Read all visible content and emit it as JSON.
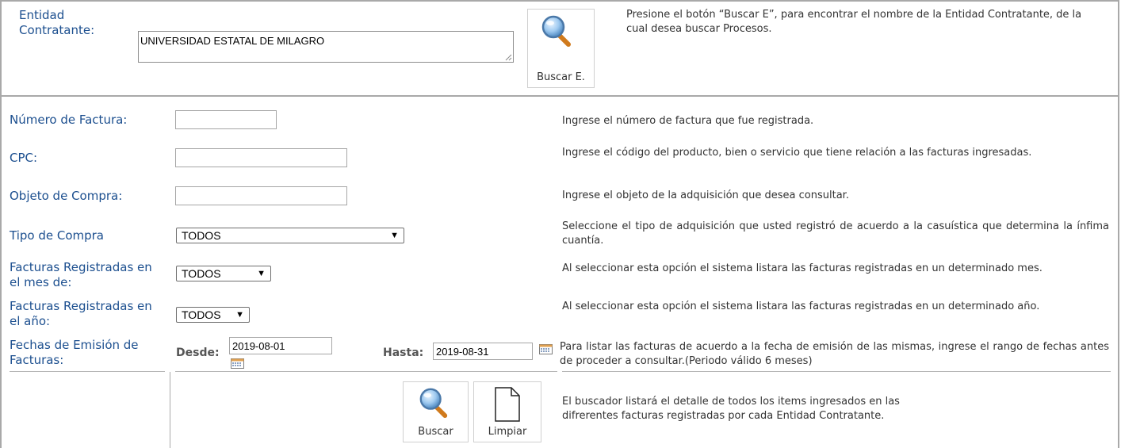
{
  "entidad": {
    "label": "Entidad Contratante:",
    "value": "UNIVERSIDAD ESTATAL DE MILAGRO",
    "search_button": "Buscar E.",
    "help": "Presione el botón “Buscar E”, para encontrar el nombre de la Entidad Contratante, de la cual desea buscar Procesos."
  },
  "fields": {
    "numero_factura": {
      "label": "Número de Factura:",
      "value": "",
      "help": "Ingrese el número de factura que fue registrada."
    },
    "cpc": {
      "label": "CPC:",
      "value": "",
      "help": "Ingrese el código del producto, bien o servicio que tiene relación a las facturas ingresadas."
    },
    "objeto_compra": {
      "label": "Objeto de Compra:",
      "value": "",
      "help": "Ingrese el objeto de la adquisición que desea consultar."
    },
    "tipo_compra": {
      "label": "Tipo de Compra",
      "selected": "TODOS",
      "help": "Seleccione el tipo de adquisición que usted registró de acuerdo a la casuística que determina la ínfima cuantía."
    },
    "mes": {
      "label": "Facturas Registradas en el mes de:",
      "selected": "TODOS",
      "help": "Al seleccionar esta opción el sistema listara las facturas registradas en un determinado mes."
    },
    "anio": {
      "label": "Facturas Registradas en el año:",
      "selected": "TODOS",
      "help": "Al seleccionar esta opción el sistema listara las facturas registradas en un determinado año."
    },
    "fechas": {
      "label": "Fechas de Emisión de Facturas:",
      "desde_label": "Desde:",
      "desde_value": "2019-08-01",
      "hasta_label": "Hasta:",
      "hasta_value": "2019-08-31",
      "help": "Para listar las facturas de acuerdo a la fecha de emisión de las mismas, ingrese el rango de fechas antes de proceder a consultar.(Periodo válido 6 meses)"
    }
  },
  "actions": {
    "search_label": "Buscar",
    "clear_label": "Limpiar",
    "help": "El buscador listará el detalle de todos los items ingresados en las difrerentes facturas registradas por cada Entidad Contratante."
  },
  "colors": {
    "label": "#1c4f8f",
    "border": "#a9a9a9"
  },
  "icons": [
    "magnifier-icon",
    "blank-document-icon",
    "calendar-icon",
    "resize-grip-icon"
  ]
}
